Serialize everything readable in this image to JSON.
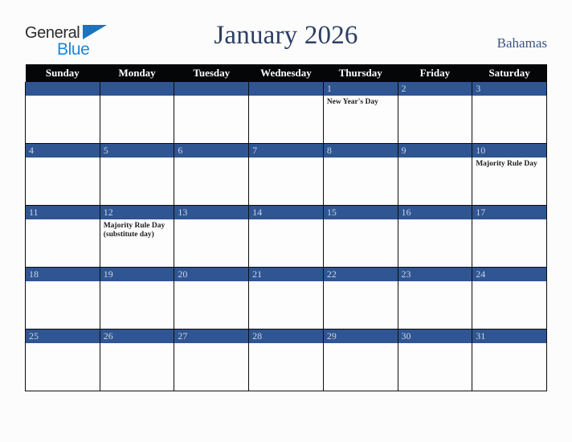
{
  "brand": {
    "name_part1": "General",
    "name_part2": "Blue",
    "triangle_color": "#1e73be",
    "part1_color": "#2b2b2b",
    "part2_color": "#1e86d6"
  },
  "header": {
    "title": "January 2026",
    "country": "Bahamas",
    "title_color": "#2c3f63",
    "country_color": "#3d5480"
  },
  "theme": {
    "day_bar_color": "#2f5592",
    "weekday_header_bg": "#050608",
    "weekday_header_text": "#ffffff",
    "day_number_text": "#ccd4e4",
    "cell_bg": "#fdfdfd",
    "page_bg": "#fcfcfd",
    "grid_line": "#0b0d10"
  },
  "weekdays": [
    "Sunday",
    "Monday",
    "Tuesday",
    "Wednesday",
    "Thursday",
    "Friday",
    "Saturday"
  ],
  "weeks": [
    [
      {
        "day": "",
        "events": []
      },
      {
        "day": "",
        "events": []
      },
      {
        "day": "",
        "events": []
      },
      {
        "day": "",
        "events": []
      },
      {
        "day": "1",
        "events": [
          "New Year's Day"
        ]
      },
      {
        "day": "2",
        "events": []
      },
      {
        "day": "3",
        "events": []
      }
    ],
    [
      {
        "day": "4",
        "events": []
      },
      {
        "day": "5",
        "events": []
      },
      {
        "day": "6",
        "events": []
      },
      {
        "day": "7",
        "events": []
      },
      {
        "day": "8",
        "events": []
      },
      {
        "day": "9",
        "events": []
      },
      {
        "day": "10",
        "events": [
          "Majority Rule Day"
        ]
      }
    ],
    [
      {
        "day": "11",
        "events": []
      },
      {
        "day": "12",
        "events": [
          "Majority Rule Day (substitute day)"
        ]
      },
      {
        "day": "13",
        "events": []
      },
      {
        "day": "14",
        "events": []
      },
      {
        "day": "15",
        "events": []
      },
      {
        "day": "16",
        "events": []
      },
      {
        "day": "17",
        "events": []
      }
    ],
    [
      {
        "day": "18",
        "events": []
      },
      {
        "day": "19",
        "events": []
      },
      {
        "day": "20",
        "events": []
      },
      {
        "day": "21",
        "events": []
      },
      {
        "day": "22",
        "events": []
      },
      {
        "day": "23",
        "events": []
      },
      {
        "day": "24",
        "events": []
      }
    ],
    [
      {
        "day": "25",
        "events": []
      },
      {
        "day": "26",
        "events": []
      },
      {
        "day": "27",
        "events": []
      },
      {
        "day": "28",
        "events": []
      },
      {
        "day": "29",
        "events": []
      },
      {
        "day": "30",
        "events": []
      },
      {
        "day": "31",
        "events": []
      }
    ]
  ]
}
